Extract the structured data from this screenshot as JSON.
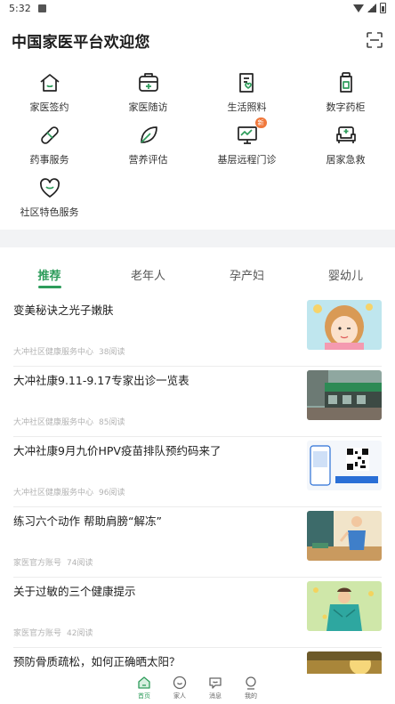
{
  "status_bar": {
    "time": "5:32"
  },
  "header": {
    "title": "中国家医平台欢迎您",
    "scan_icon": "scan-icon"
  },
  "services": [
    {
      "label": "家医签约",
      "icon": "house-icon"
    },
    {
      "label": "家医随访",
      "icon": "medkit-icon"
    },
    {
      "label": "生活照料",
      "icon": "care-doc-icon"
    },
    {
      "label": "数字药柜",
      "icon": "medicine-bottle-icon"
    },
    {
      "label": "药事服务",
      "icon": "pill-icon"
    },
    {
      "label": "营养评估",
      "icon": "leaf-icon"
    },
    {
      "label": "基层远程门诊",
      "icon": "monitor-icon",
      "badge": "新"
    },
    {
      "label": "居家急救",
      "icon": "sofa-cross-icon"
    },
    {
      "label": "社区特色服务",
      "icon": "heart-shield-icon"
    }
  ],
  "tabs": [
    {
      "label": "推荐",
      "active": true
    },
    {
      "label": "老年人",
      "active": false
    },
    {
      "label": "孕产妇",
      "active": false
    },
    {
      "label": "婴幼儿",
      "active": false
    }
  ],
  "articles": [
    {
      "title": "变美秘诀之光子嫩肤",
      "source": "大冲社区健康服务中心",
      "stat": "38阅读",
      "thumb": "cartoon-face-thumbnail"
    },
    {
      "title": "大冲社康9.11-9.17专家出诊一览表",
      "source": "大冲社区健康服务中心",
      "stat": "85阅读",
      "thumb": "clinic-storefront-thumbnail"
    },
    {
      "title": "大冲社康9月九价HPV疫苗排队预约码来了",
      "source": "大冲社区健康服务中心",
      "stat": "96阅读",
      "thumb": "qr-code-thumbnail"
    },
    {
      "title": "练习六个动作 帮助肩膀“解冻”",
      "source": "家医官方账号",
      "stat": "74阅读",
      "thumb": "shoulder-exercise-thumbnail"
    },
    {
      "title": "关于过敏的三个健康提示",
      "source": "家医官方账号",
      "stat": "42阅读",
      "thumb": "allergy-blanket-thumbnail"
    },
    {
      "title": "预防骨质疏松，如何正确晒太阳？",
      "source": "",
      "stat": "",
      "thumb": "sunshine-thumbnail"
    }
  ],
  "bottom_nav": [
    {
      "label": "首页",
      "icon": "home-icon",
      "active": true
    },
    {
      "label": "家人",
      "icon": "family-icon",
      "active": false
    },
    {
      "label": "消息",
      "icon": "message-icon",
      "active": false
    },
    {
      "label": "我的",
      "icon": "profile-icon",
      "active": false
    }
  ],
  "colors": {
    "accent": "#2e9c5b",
    "badge": "#f0783c",
    "divider": "#f2f3f5"
  }
}
